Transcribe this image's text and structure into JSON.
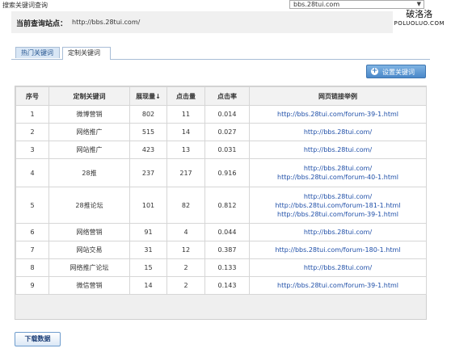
{
  "topbar": {
    "label": "搜索关键词查询",
    "site_select_value": "bbs.28tui.com"
  },
  "watermark": {
    "cn": "破洛洛",
    "en": "POLUOLUO.COM"
  },
  "current": {
    "label": "当前查询站点：",
    "url": "http://bbs.28tui.com/"
  },
  "tabs": [
    {
      "label": "热门关键词",
      "active": false
    },
    {
      "label": "定制关键词",
      "active": true
    }
  ],
  "set_keyword_button": "设置关键词",
  "table": {
    "headers": [
      "序号",
      "定制关键词",
      "展现量",
      "点击量",
      "点击率",
      "网页链接举例"
    ],
    "rows": [
      {
        "no": "1",
        "keyword": "微博营销",
        "views": "802",
        "clicks": "11",
        "ctr": "0.014",
        "urls": [
          "http://bbs.28tui.com/forum-39-1.html"
        ]
      },
      {
        "no": "2",
        "keyword": "网络推广",
        "views": "515",
        "clicks": "14",
        "ctr": "0.027",
        "urls": [
          "http://bbs.28tui.com/"
        ]
      },
      {
        "no": "3",
        "keyword": "网站推广",
        "views": "423",
        "clicks": "13",
        "ctr": "0.031",
        "urls": [
          "http://bbs.28tui.com/"
        ]
      },
      {
        "no": "4",
        "keyword": "28推",
        "views": "237",
        "clicks": "217",
        "ctr": "0.916",
        "urls": [
          "http://bbs.28tui.com/",
          "http://bbs.28tui.com/forum-40-1.html"
        ]
      },
      {
        "no": "5",
        "keyword": "28推论坛",
        "views": "101",
        "clicks": "82",
        "ctr": "0.812",
        "urls": [
          "http://bbs.28tui.com/",
          "http://bbs.28tui.com/forum-181-1.html",
          "http://bbs.28tui.com/forum-39-1.html"
        ]
      },
      {
        "no": "6",
        "keyword": "网络营销",
        "views": "91",
        "clicks": "4",
        "ctr": "0.044",
        "urls": [
          "http://bbs.28tui.com/"
        ]
      },
      {
        "no": "7",
        "keyword": "网站交易",
        "views": "31",
        "clicks": "12",
        "ctr": "0.387",
        "urls": [
          "http://bbs.28tui.com/forum-180-1.html"
        ]
      },
      {
        "no": "8",
        "keyword": "网络推广论坛",
        "views": "15",
        "clicks": "2",
        "ctr": "0.133",
        "urls": [
          "http://bbs.28tui.com/"
        ]
      },
      {
        "no": "9",
        "keyword": "微信营销",
        "views": "14",
        "clicks": "2",
        "ctr": "0.143",
        "urls": [
          "http://bbs.28tui.com/forum-39-1.html"
        ]
      }
    ]
  },
  "download_button": "下载数据"
}
